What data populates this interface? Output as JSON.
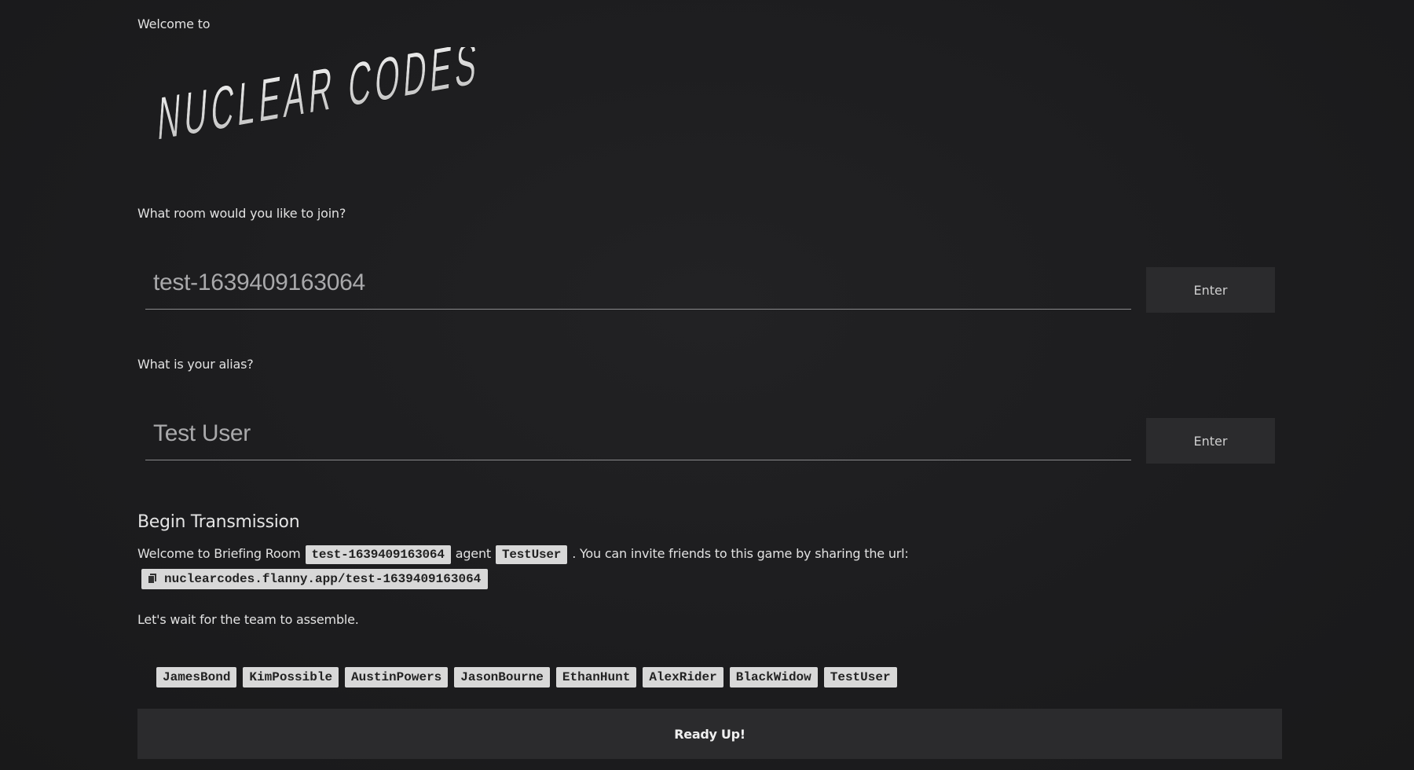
{
  "intro": {
    "welcome_text": "Welcome to",
    "logo_text": "NUCLEAR CODES"
  },
  "room": {
    "question": "What room would you like to join?",
    "placeholder": "test-1639409163064",
    "enter_label": "Enter"
  },
  "alias": {
    "question": "What is your alias?",
    "placeholder": "Test User",
    "enter_label": "Enter"
  },
  "transmission": {
    "title": "Begin Transmission",
    "welcome_prefix": "Welcome to Briefing Room",
    "room_code": "test-1639409163064",
    "agent_word": "agent",
    "agent_name": "TestUser",
    "invite_text": ". You can invite friends to this game by sharing the url:",
    "share_url": "nuclearcodes.flanny.app/test-1639409163064",
    "wait_text": "Let's wait for the team to assemble."
  },
  "team": [
    "JamesBond",
    "KimPossible",
    "AustinPowers",
    "JasonBourne",
    "EthanHunt",
    "AlexRider",
    "BlackWidow",
    "TestUser"
  ],
  "ready_label": "Ready Up!",
  "colors": {
    "background": "#1e1e20",
    "button": "#2b2b2d",
    "chip": "#d8d8d8",
    "text": "#e6e6e6"
  }
}
